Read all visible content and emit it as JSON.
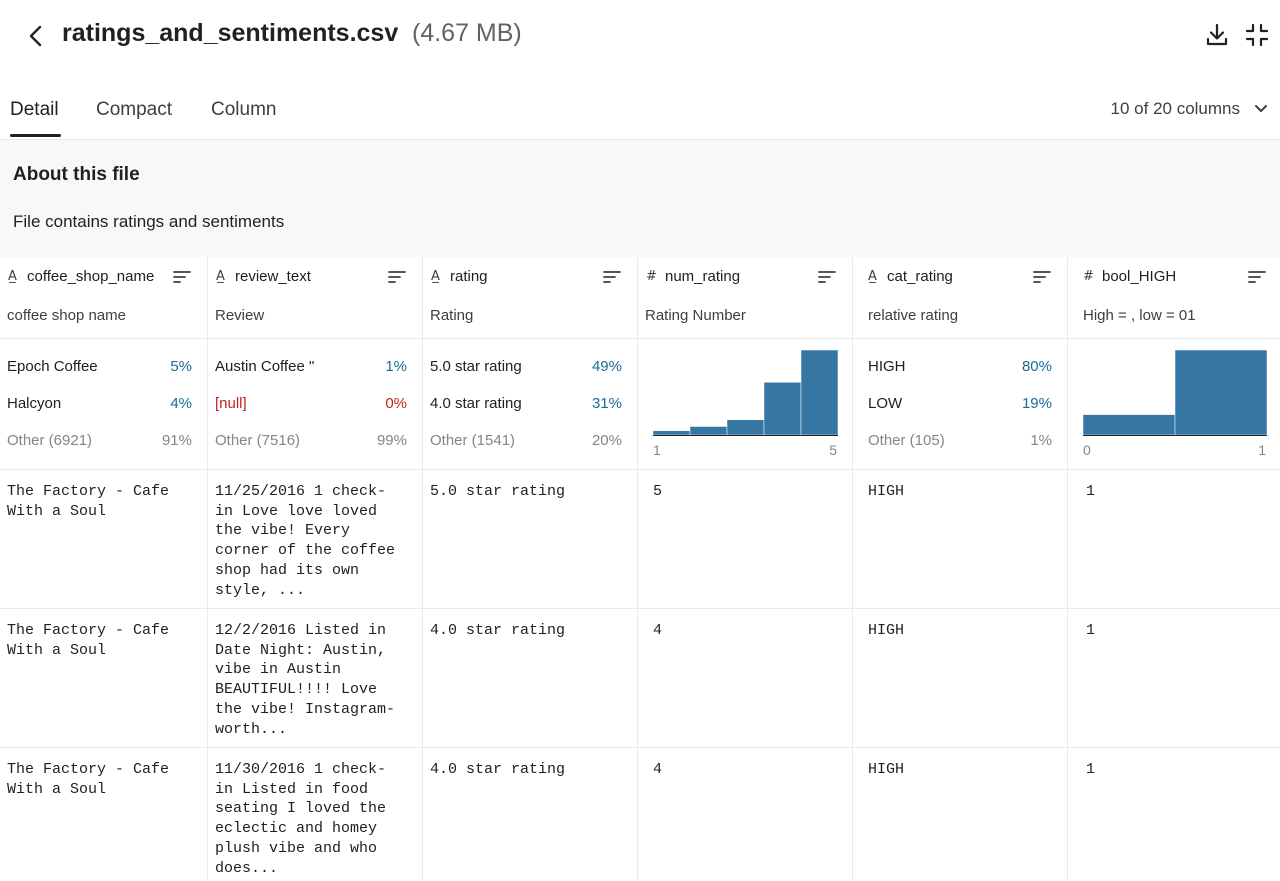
{
  "header": {
    "file_name": "ratings_and_sentiments.csv",
    "file_size": "(4.67 MB)"
  },
  "tabs": [
    {
      "label": "Detail",
      "active": true
    },
    {
      "label": "Compact",
      "active": false
    },
    {
      "label": "Column",
      "active": false
    }
  ],
  "column_selector": "10 of 20 columns",
  "about": {
    "title": "About this file",
    "description": "File contains ratings and sentiments"
  },
  "columns": [
    {
      "name": "coffee_shop_name",
      "type_icon": "string-type-icon",
      "description": "coffee shop name",
      "stats": [
        {
          "label": "Epoch Coffee",
          "pct": "5%"
        },
        {
          "label": "Halcyon",
          "pct": "4%"
        },
        {
          "label": "Other (6921)",
          "pct": "91%"
        }
      ]
    },
    {
      "name": "review_text",
      "type_icon": "string-type-icon",
      "description": "Review",
      "stats": [
        {
          "label": "Austin Coffee \"",
          "pct": "1%"
        },
        {
          "label": "[null]",
          "pct": "0%"
        },
        {
          "label": "Other (7516)",
          "pct": "99%"
        }
      ]
    },
    {
      "name": "rating",
      "type_icon": "string-type-icon",
      "description": "Rating",
      "stats": [
        {
          "label": "5.0 star rating",
          "pct": "49%"
        },
        {
          "label": "4.0 star rating",
          "pct": "31%"
        },
        {
          "label": "Other (1541)",
          "pct": "20%"
        }
      ]
    },
    {
      "name": "num_rating",
      "type_icon": "numeric-type-icon",
      "description": "Rating Number",
      "histogram": {
        "min_label": "1",
        "max_label": "5",
        "values": [
          0.05,
          0.1,
          0.18,
          0.62,
          1.0
        ]
      }
    },
    {
      "name": "cat_rating",
      "type_icon": "string-type-icon",
      "description": "relative rating",
      "stats": [
        {
          "label": "HIGH",
          "pct": "80%"
        },
        {
          "label": "LOW",
          "pct": "19%"
        },
        {
          "label": "Other (105)",
          "pct": "1%"
        }
      ]
    },
    {
      "name": "bool_HIGH",
      "type_icon": "numeric-type-icon",
      "description": "High = , low = 01",
      "histogram": {
        "min_label": "0",
        "max_label": "1",
        "values": [
          0.24,
          1.0
        ]
      }
    }
  ],
  "rows": [
    {
      "coffee_shop_name": "The Factory - Cafe\nWith a Soul",
      "review_text": "11/25/2016 1 check-\nin Love love loved\nthe vibe! Every\ncorner of the coffee\nshop had its own\nstyle, ...",
      "rating": "5.0 star rating",
      "num_rating": "5",
      "cat_rating": "HIGH",
      "bool_HIGH": "1"
    },
    {
      "coffee_shop_name": "The Factory - Cafe\nWith a Soul",
      "review_text": "12/2/2016 Listed in\nDate Night: Austin,\nvibe in Austin\nBEAUTIFUL!!!! Love\nthe vibe! Instagram-\nworth...",
      "rating": "4.0 star rating",
      "num_rating": "4",
      "cat_rating": "HIGH",
      "bool_HIGH": "1"
    },
    {
      "coffee_shop_name": "The Factory - Cafe\nWith a Soul",
      "review_text": "11/30/2016 1 check-\nin Listed in food\nseating I loved the\neclectic and homey\nplush vibe and who\ndoes...",
      "rating": "4.0 star rating",
      "num_rating": "4",
      "cat_rating": "HIGH",
      "bool_HIGH": "1"
    }
  ],
  "colors": {
    "histogram_bar": "#3576a3",
    "percent_text": "#1a6b9a",
    "null_text": "#c5221f"
  }
}
